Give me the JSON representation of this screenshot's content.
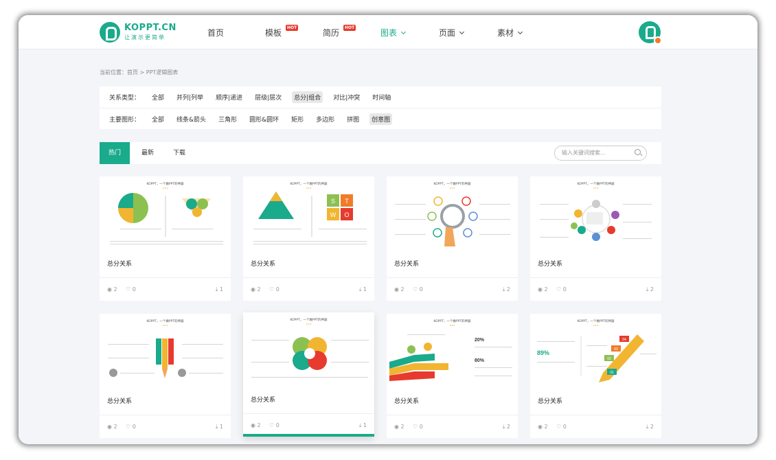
{
  "brand": {
    "name": "KOPPT.CN",
    "slogan": "让演示更简单"
  },
  "nav": [
    {
      "label": "首页",
      "hot": false,
      "dropdown": false
    },
    {
      "label": "模板",
      "hot": true,
      "dropdown": false
    },
    {
      "label": "简历",
      "hot": true,
      "dropdown": false
    },
    {
      "label": "图表",
      "hot": false,
      "dropdown": true,
      "active": true
    },
    {
      "label": "页面",
      "hot": false,
      "dropdown": true
    },
    {
      "label": "素材",
      "hot": false,
      "dropdown": true
    }
  ],
  "hot_badge": "HOT",
  "breadcrumb": "当前位置：首页 > PPT逻辑图表",
  "filters": [
    {
      "label": "关系类型：",
      "options": [
        "全部",
        "并列|列举",
        "顺序|递进",
        "层级|层次",
        "总分|组合",
        "对比|冲突",
        "时间轴"
      ],
      "selected": "总分|组合"
    },
    {
      "label": "主要图形：",
      "options": [
        "全部",
        "线条&箭头",
        "三角形",
        "圆形&圆环",
        "矩形",
        "多边形",
        "拼图",
        "创意图"
      ],
      "selected": "创意图"
    }
  ],
  "tabs": [
    "热门",
    "最新",
    "下载"
  ],
  "active_tab": "热门",
  "search": {
    "placeholder": "输入关键词搜索..."
  },
  "thumb_title": "KOPPT，一个做PPT的神器",
  "thumb_stars": "★★★",
  "cards": [
    {
      "title": "总分关系",
      "views": "2",
      "likes": "0",
      "downloads": "1"
    },
    {
      "title": "总分关系",
      "views": "2",
      "likes": "0",
      "downloads": "1"
    },
    {
      "title": "总分关系",
      "views": "2",
      "likes": "0",
      "downloads": "2"
    },
    {
      "title": "总分关系",
      "views": "2",
      "likes": "0",
      "downloads": "2"
    },
    {
      "title": "总分关系",
      "views": "2",
      "likes": "0",
      "downloads": "1"
    },
    {
      "title": "总分关系",
      "views": "2",
      "likes": "0",
      "downloads": "1"
    },
    {
      "title": "总分关系",
      "views": "2",
      "likes": "0",
      "downloads": "2"
    },
    {
      "title": "总分关系",
      "views": "2",
      "likes": "0",
      "downloads": "2"
    }
  ],
  "thumb_text": {
    "swot": [
      "S",
      "T",
      "W",
      "O"
    ],
    "pct_a": "20%",
    "pct_b": "80%",
    "pct_c": "89%",
    "pencil": [
      "04",
      "03",
      "02",
      "01"
    ]
  },
  "colors": {
    "accent": "#1aaa8c",
    "hot": "#e63b2e",
    "page_bg": "#f4f5f8"
  },
  "icons": {
    "view": "eye-icon",
    "like": "heart-icon",
    "download": "download-icon",
    "search": "search-icon",
    "dropdown": "chevron-down-icon"
  }
}
